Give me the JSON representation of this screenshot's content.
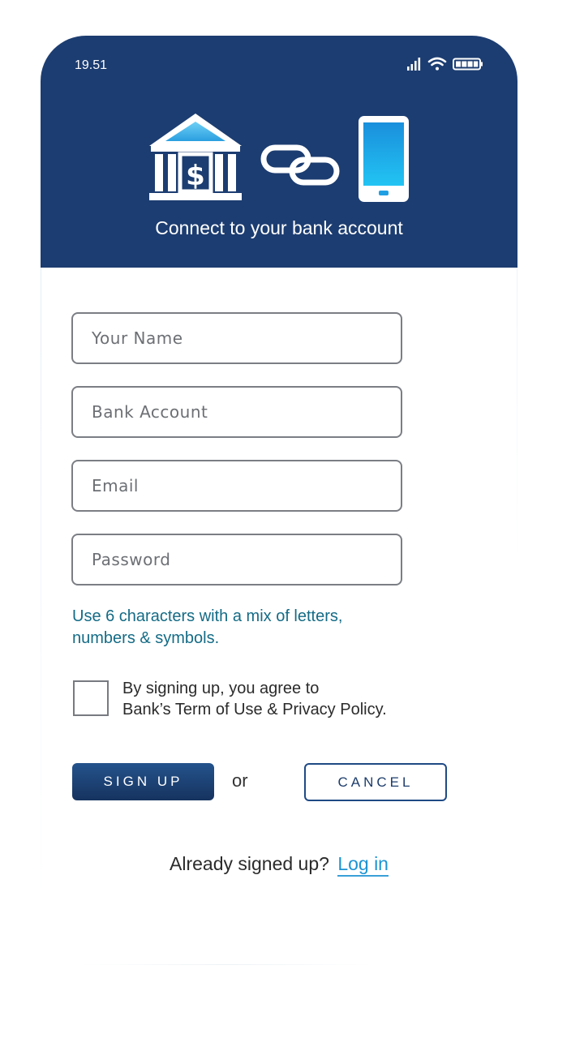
{
  "status_bar": {
    "time": "19.51",
    "icons": [
      "signal-icon",
      "wifi-icon",
      "battery-icon"
    ]
  },
  "header": {
    "title": "Connect to your bank account",
    "illustration_icons": [
      "bank-icon",
      "chain-link-icon",
      "smartphone-icon"
    ],
    "background_color": "#1c3d71"
  },
  "form": {
    "name_placeholder": "Your Name",
    "bank_account_placeholder": "Bank Account",
    "email_placeholder": "Email",
    "password_placeholder": "Password",
    "password_hint_line1": "Use 6 characters with a mix of letters,",
    "password_hint_line2": "numbers & symbols.",
    "agree_line1": "By signing up, you agree to",
    "agree_line2": "Bank’s Term of Use & Privacy Policy.",
    "terms_checked": false
  },
  "actions": {
    "signup_label": "SIGN UP",
    "or_label": "or",
    "cancel_label": "CANCEL"
  },
  "footer": {
    "already_text": "Already signed up?",
    "login_label": "Log in"
  },
  "colors": {
    "accent": "#1c3d71",
    "hint": "#146b86",
    "link": "#1b93d3"
  }
}
